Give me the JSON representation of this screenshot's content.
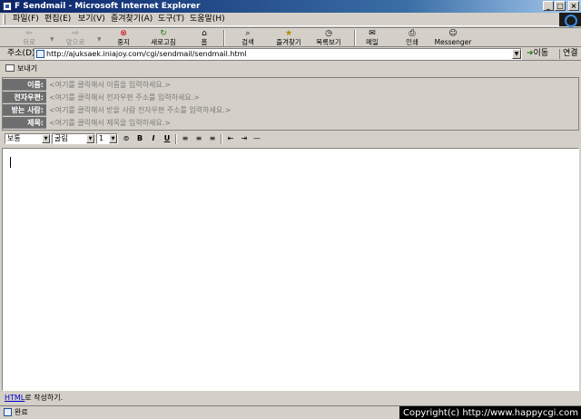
{
  "window": {
    "title": "F Sendmail - Microsoft Internet Explorer",
    "min_glyph": "_",
    "max_glyph": "□",
    "close_glyph": "×"
  },
  "menu": [
    "파일(F)",
    "편집(E)",
    "보기(V)",
    "즐겨찾기(A)",
    "도구(T)",
    "도움말(H)"
  ],
  "toolbar": {
    "back": "뒤로",
    "forward": "앞으로",
    "stop": "중지",
    "refresh": "새로고침",
    "home": "홈",
    "search": "검색",
    "favorites": "즐겨찾기",
    "history": "목록보기",
    "mail": "메일",
    "print": "인쇄",
    "messenger": "Messenger"
  },
  "address": {
    "label": "주소(D)",
    "url": "http://ajuksaek.iniajoy.com/cgi/sendmail/sendmail.html",
    "go": "이동",
    "links": "연결"
  },
  "send": {
    "label": "보내기"
  },
  "form": {
    "name_label": "이름:",
    "name_placeholder": "<여기를 클릭해서 이름을 입력하세요.>",
    "email_label": "전자우편:",
    "email_placeholder": "<여기를 클릭해서 전자우편 주소를 입력하세요.>",
    "to_label": "받는 사람:",
    "to_placeholder": "<여기를 클릭해서 받을 사람 전자우편 주소를 입력하세요.>",
    "subject_label": "제목:",
    "subject_placeholder": "<여기를 클릭해서 제목을 입력하세요.>"
  },
  "format": {
    "style": "보통",
    "font": "굴림",
    "size": "1",
    "bold": "B",
    "italic": "I",
    "underline": "U"
  },
  "editor": {
    "text": ""
  },
  "html_link": {
    "link": "HTML",
    "suffix": "로 작성하기."
  },
  "status": {
    "text": "완료",
    "copyright": "Copyright(c) http://www.happycgi.com"
  }
}
